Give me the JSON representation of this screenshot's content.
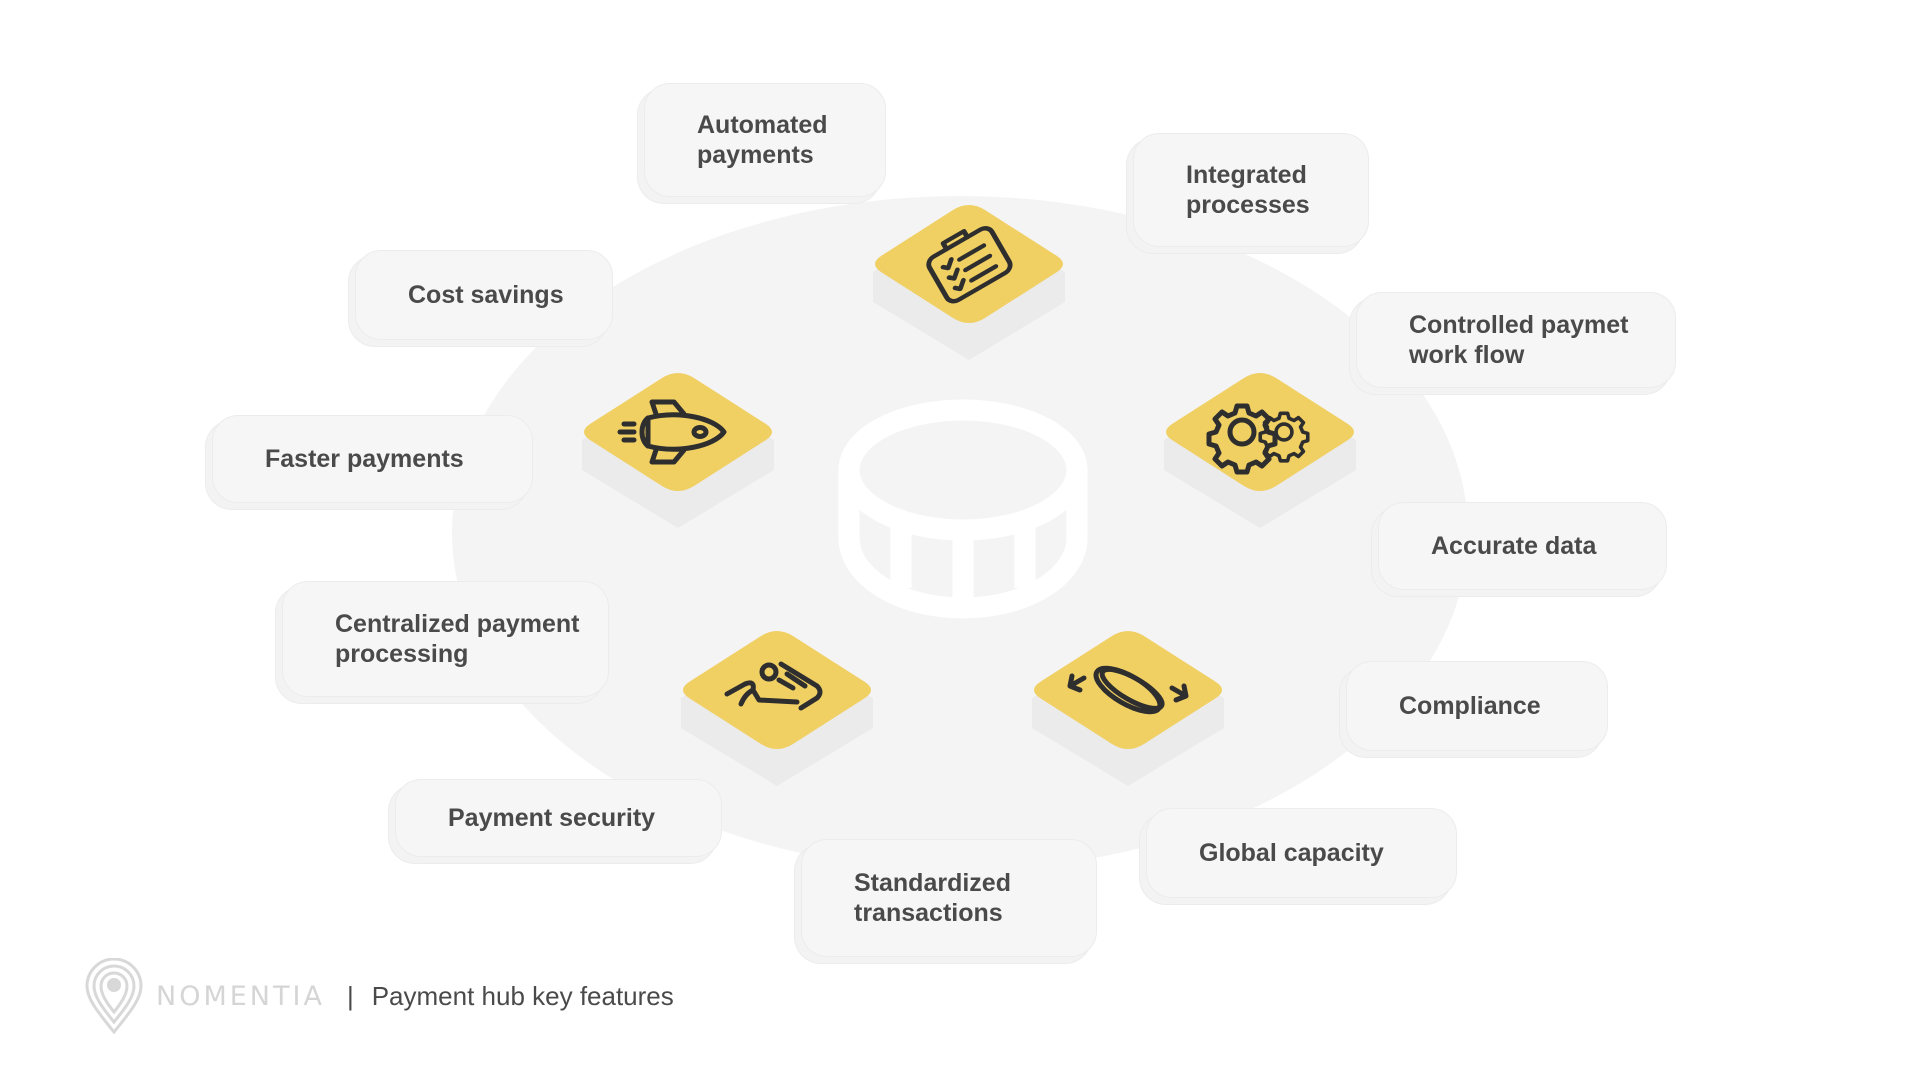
{
  "title": "Payment hub key features",
  "brand": "NOMENTIA",
  "separator": "|",
  "colors": {
    "tile_face": "#f0cf63",
    "tile_side": "#ebebeb",
    "icon_stroke": "#2e2e2e",
    "disk": "#f4f4f4",
    "label_bg": "#f6f6f6",
    "label_text": "#4a4a4a",
    "center_icon": "#ffffff",
    "brand_text": "#d5d5d5"
  },
  "center": {
    "icon": "database-icon"
  },
  "tiles": [
    {
      "id": "automation",
      "icon": "clipboard-checklist-icon"
    },
    {
      "id": "speed",
      "icon": "rocket-icon"
    },
    {
      "id": "workflow",
      "icon": "gears-icon"
    },
    {
      "id": "processing",
      "icon": "payment-person-icon"
    },
    {
      "id": "global",
      "icon": "rotating-coin-icon"
    }
  ],
  "features": [
    {
      "label": "Automated\npayments"
    },
    {
      "label": "Integrated\nprocesses"
    },
    {
      "label": "Cost savings"
    },
    {
      "label": "Controlled paymet\nwork flow"
    },
    {
      "label": "Faster payments"
    },
    {
      "label": "Accurate data"
    },
    {
      "label": "Centralized payment\nprocessing"
    },
    {
      "label": "Compliance"
    },
    {
      "label": "Payment security"
    },
    {
      "label": "Global capacity"
    },
    {
      "label": "Standardized\ntransactions"
    }
  ]
}
